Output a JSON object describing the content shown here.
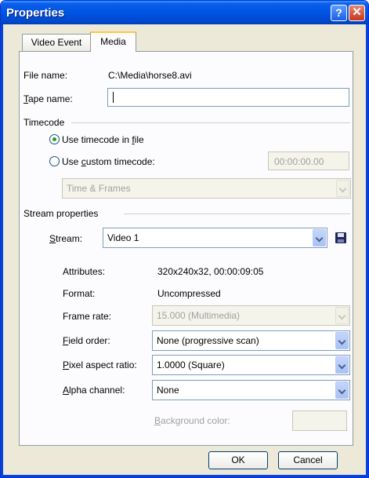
{
  "window": {
    "title": "Properties",
    "help_glyph": "?",
    "close_glyph": "✕"
  },
  "tabs": [
    {
      "label": "Video Event",
      "active": false
    },
    {
      "label": "Media",
      "active": true
    }
  ],
  "file": {
    "label": "File name:",
    "value": "C:\\Media\\horse8.avi"
  },
  "tape": {
    "label_prefix": "T",
    "label_rest": "ape name:",
    "value": ""
  },
  "timecode": {
    "group_label": "Timecode",
    "option_file_prefix": "Use timecode in ",
    "option_file_key": "f",
    "option_file_rest": "ile",
    "option_custom_prefix": "Use ",
    "option_custom_key": "c",
    "option_custom_rest": "ustom timecode:",
    "custom_value": "00:00:00.00",
    "format_value": "Time & Frames",
    "selected": "file"
  },
  "stream": {
    "group_label": "Stream properties",
    "label_key": "S",
    "label_rest": "tream:",
    "value": "Video 1",
    "attributes_label": "Attributes:",
    "attributes_value": "320x240x32, 00:00:09:05",
    "format_label": "Format:",
    "format_value": "Uncompressed",
    "frame_rate_label": "Frame rate:",
    "frame_rate_value": "15.000 (Multimedia)",
    "field_order_key": "F",
    "field_order_rest": "ield order:",
    "field_order_value": "None (progressive scan)",
    "pixel_aspect_key": "P",
    "pixel_aspect_rest": "ixel aspect ratio:",
    "pixel_aspect_value": "1.0000 (Square)",
    "alpha_key": "A",
    "alpha_rest": "lpha channel:",
    "alpha_value": "None",
    "bg_color_key": "B",
    "bg_color_rest": "ackground color:"
  },
  "buttons": {
    "ok": "OK",
    "cancel": "Cancel"
  },
  "colors": {
    "title_bar": "#0054e3",
    "dialog_bg": "#ece9d8",
    "panel_bg": "#fcfcfe",
    "radio_selected": "#21a121",
    "tab_highlight": "#ffc83c"
  },
  "icons": {
    "save": "save-icon",
    "dropdown": "chevron-down-icon"
  }
}
